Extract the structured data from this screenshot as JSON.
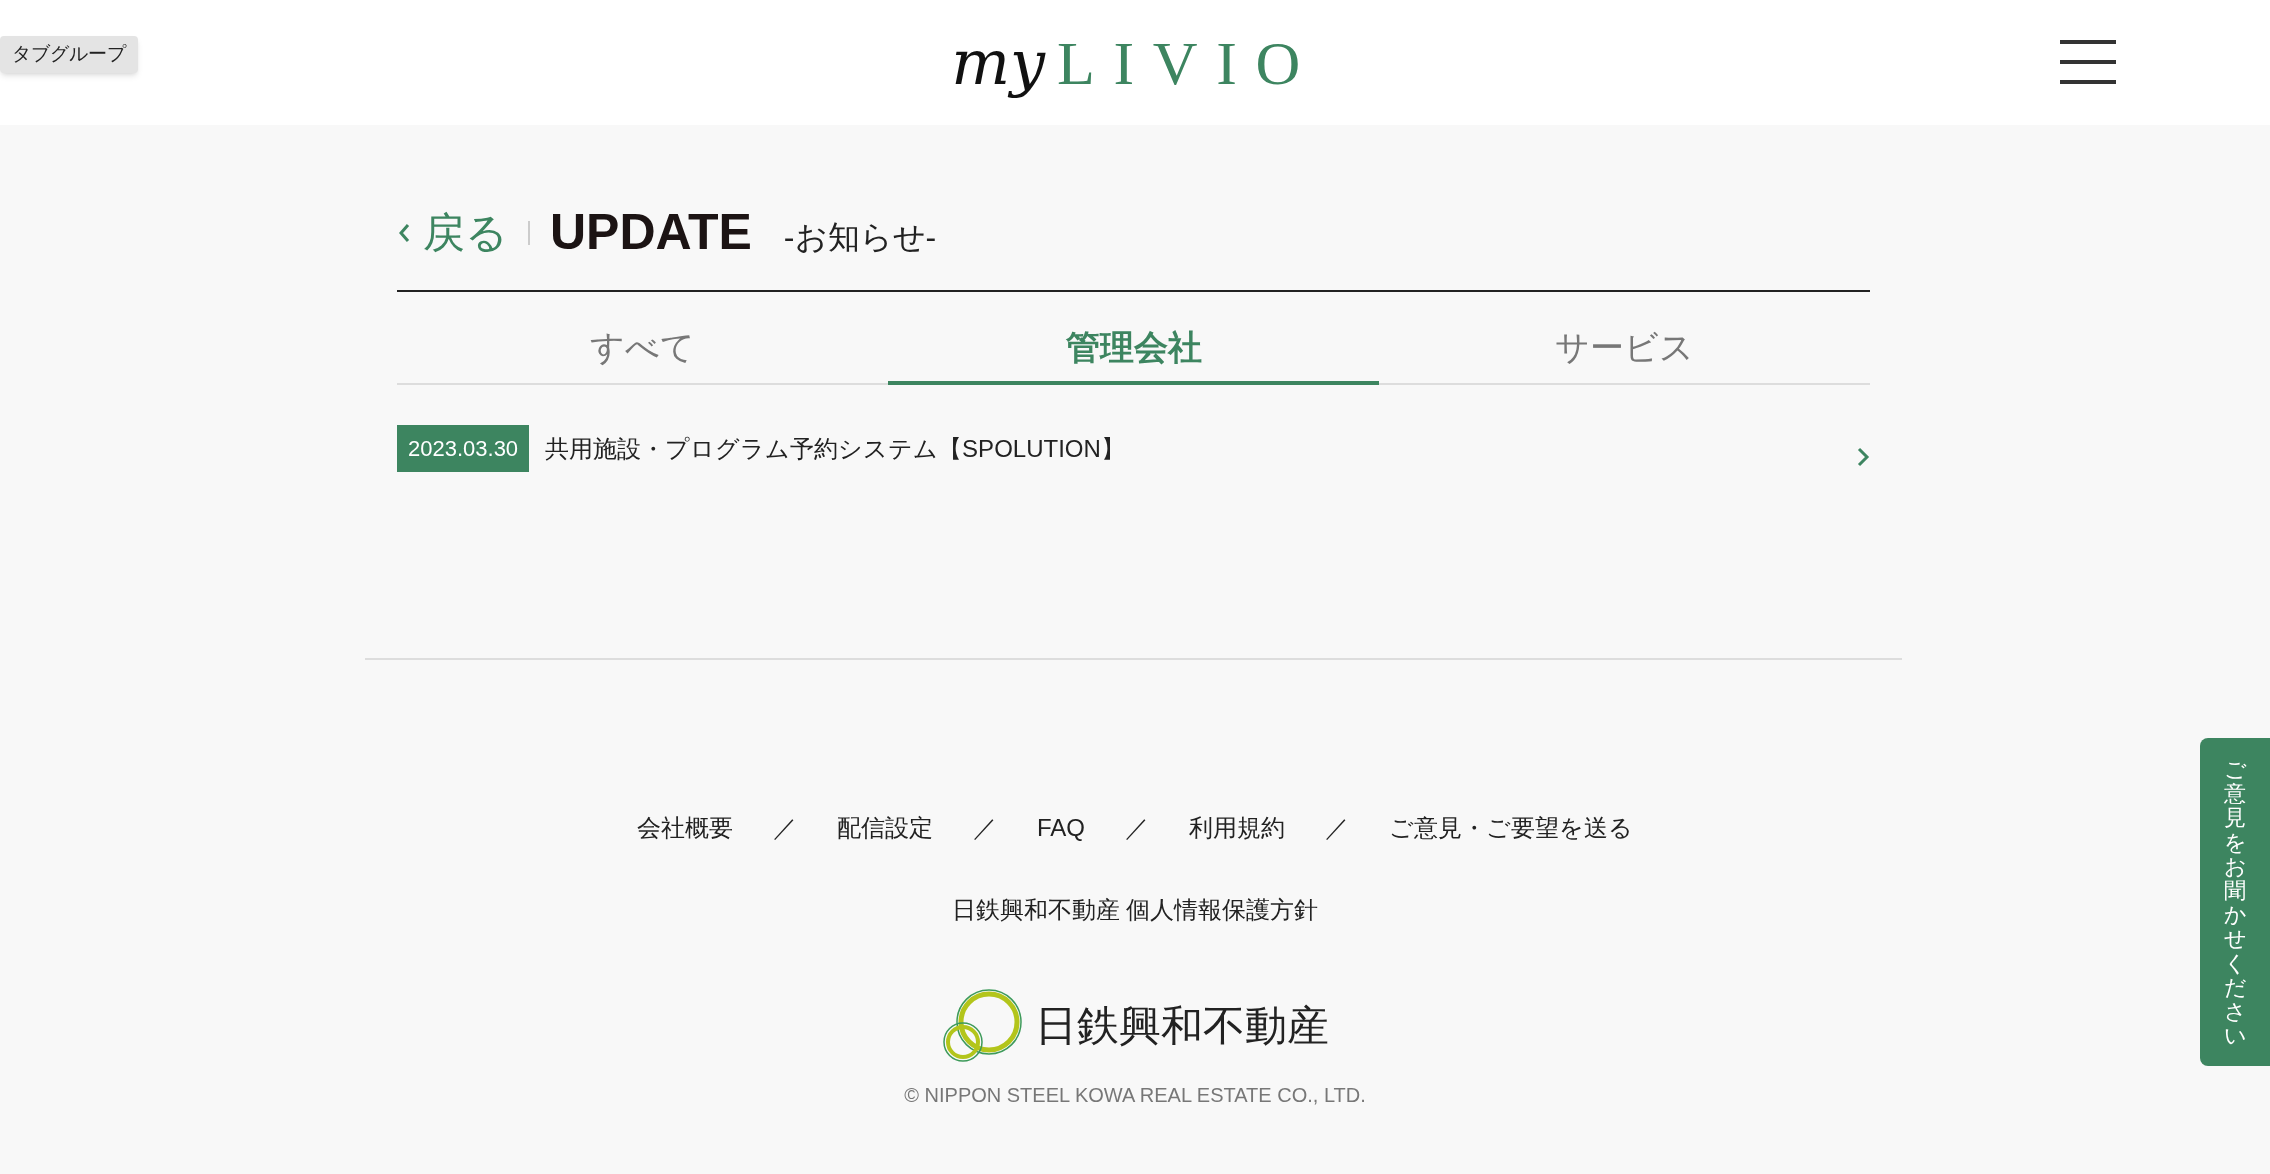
{
  "tab_group_label": "タブグループ",
  "logo": {
    "script": "my",
    "wordmark": "LIVIO"
  },
  "back_link": "戻る",
  "page_title": "UPDATE",
  "page_subtitle": "-お知らせ-",
  "tabs": [
    {
      "label": "すべて",
      "selected": false
    },
    {
      "label": "管理会社",
      "selected": true
    },
    {
      "label": "サービス",
      "selected": false
    }
  ],
  "news": [
    {
      "date": "2023.03.30",
      "title": "共用施設・プログラム予約システム【SPOLUTION】"
    }
  ],
  "footer": {
    "links": [
      "会社概要",
      "配信設定",
      "FAQ",
      "利用規約",
      "ご意見・ご要望を送る"
    ],
    "separator": "／",
    "policy": "日鉄興和不動産 個人情報保護方針",
    "company_name": "日鉄興和不動産",
    "copyright": "© NIPPON STEEL KOWA REAL ESTATE CO., LTD."
  },
  "feedback_tab": "ご意見をお聞かせください"
}
